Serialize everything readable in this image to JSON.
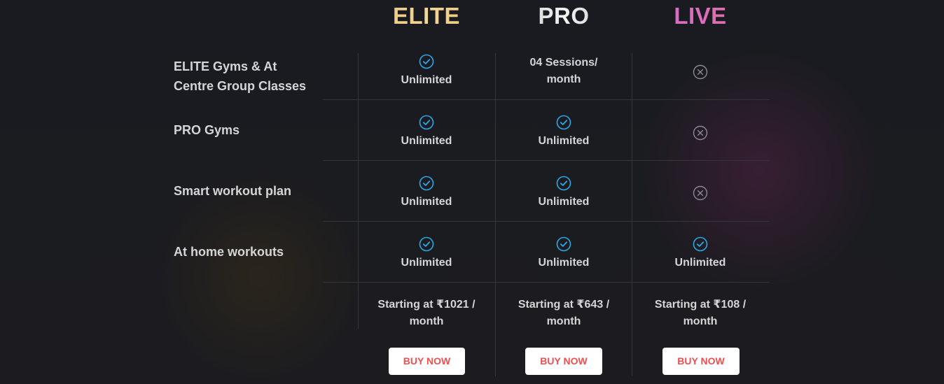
{
  "plans": [
    {
      "name": "ELITE",
      "price_line1": "Starting at ₹1021 /",
      "price_line2": "month",
      "buy_label": "BUY NOW"
    },
    {
      "name": "PRO",
      "price_line1": "Starting at ₹643 /",
      "price_line2": "month",
      "buy_label": "BUY NOW"
    },
    {
      "name": "LIVE",
      "price_line1": "Starting at ₹108 /",
      "price_line2": "month",
      "buy_label": "BUY NOW"
    }
  ],
  "features": [
    {
      "label_line1": "ELITE Gyms & At",
      "label_line2": "Centre Group Classes",
      "elite": {
        "included": true,
        "text": "Unlimited"
      },
      "pro": {
        "included": true,
        "text_line1": "04 Sessions/",
        "text_line2": "month"
      },
      "live": {
        "included": false
      }
    },
    {
      "label_line1": "PRO Gyms",
      "elite": {
        "included": true,
        "text": "Unlimited"
      },
      "pro": {
        "included": true,
        "text": "Unlimited"
      },
      "live": {
        "included": false
      }
    },
    {
      "label_line1": "Smart workout plan",
      "elite": {
        "included": true,
        "text": "Unlimited"
      },
      "pro": {
        "included": true,
        "text": "Unlimited"
      },
      "live": {
        "included": false
      }
    },
    {
      "label_line1": "At home workouts",
      "elite": {
        "included": true,
        "text": "Unlimited"
      },
      "pro": {
        "included": true,
        "text": "Unlimited"
      },
      "live": {
        "included": true,
        "text": "Unlimited"
      }
    }
  ],
  "icons": {
    "included": "check-circle-icon",
    "excluded": "x-circle-icon"
  },
  "colors": {
    "elite_gradient": [
      "#e9bf6b",
      "#f2d79a"
    ],
    "pro_gradient": [
      "#b8b8b8",
      "#f4f4f4"
    ],
    "live_gradient": [
      "#d06ad6",
      "#e6719e"
    ],
    "check": "#2aa8e8",
    "cross": "#8a8a90",
    "buy_text": "#ef4f4f"
  }
}
